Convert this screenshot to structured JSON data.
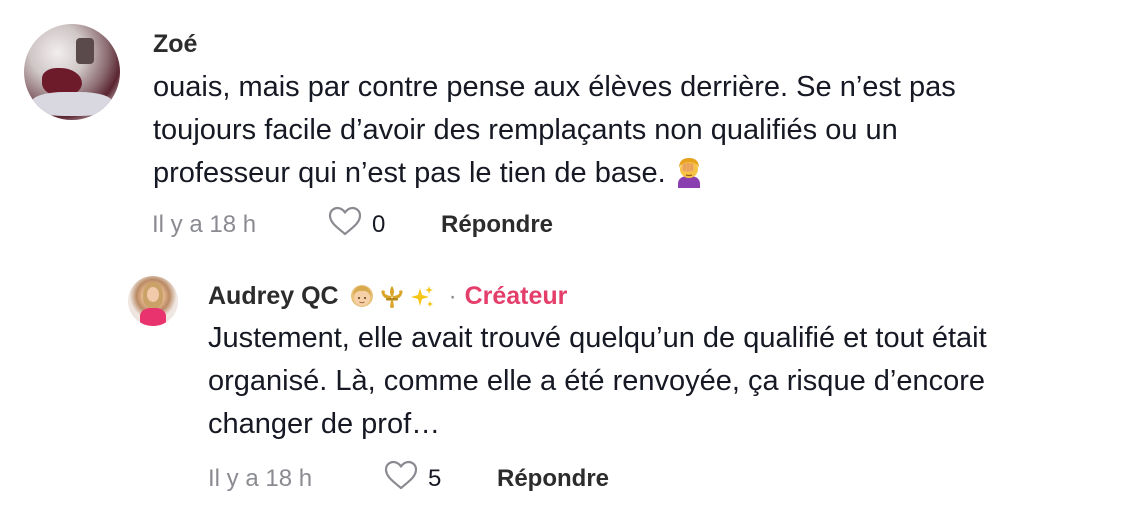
{
  "comments": [
    {
      "username": "Zoé",
      "text": "ouais, mais par contre pense aux élèves derrière. Se n’est pas\ntoujours facile d’avoir des remplaçants non qualifiés ou un\nprofesseur qui n’est pas le tien de base.",
      "text_emoji": "facepalm-emoji",
      "time": "Il y a 18 h",
      "likes": "0",
      "reply_label": "Répondre"
    },
    {
      "username": "Audrey QC",
      "username_emojis": [
        "blonde-person-emoji",
        "fleur-de-lis-emoji",
        "sparkles-emoji"
      ],
      "separator": "·",
      "badge": "Créateur",
      "text": "Justement, elle avait trouvé quelqu’un de qualifié et tout était\norganisé. Là, comme elle a été renvoyée, ça risque d’encore\nchanger de prof…",
      "time": "Il y a 18 h",
      "likes": "5",
      "reply_label": "Répondre"
    }
  ],
  "colors": {
    "creator_badge": "#e43e6b",
    "meta_text": "#8a8b91",
    "body_text": "#161823"
  }
}
